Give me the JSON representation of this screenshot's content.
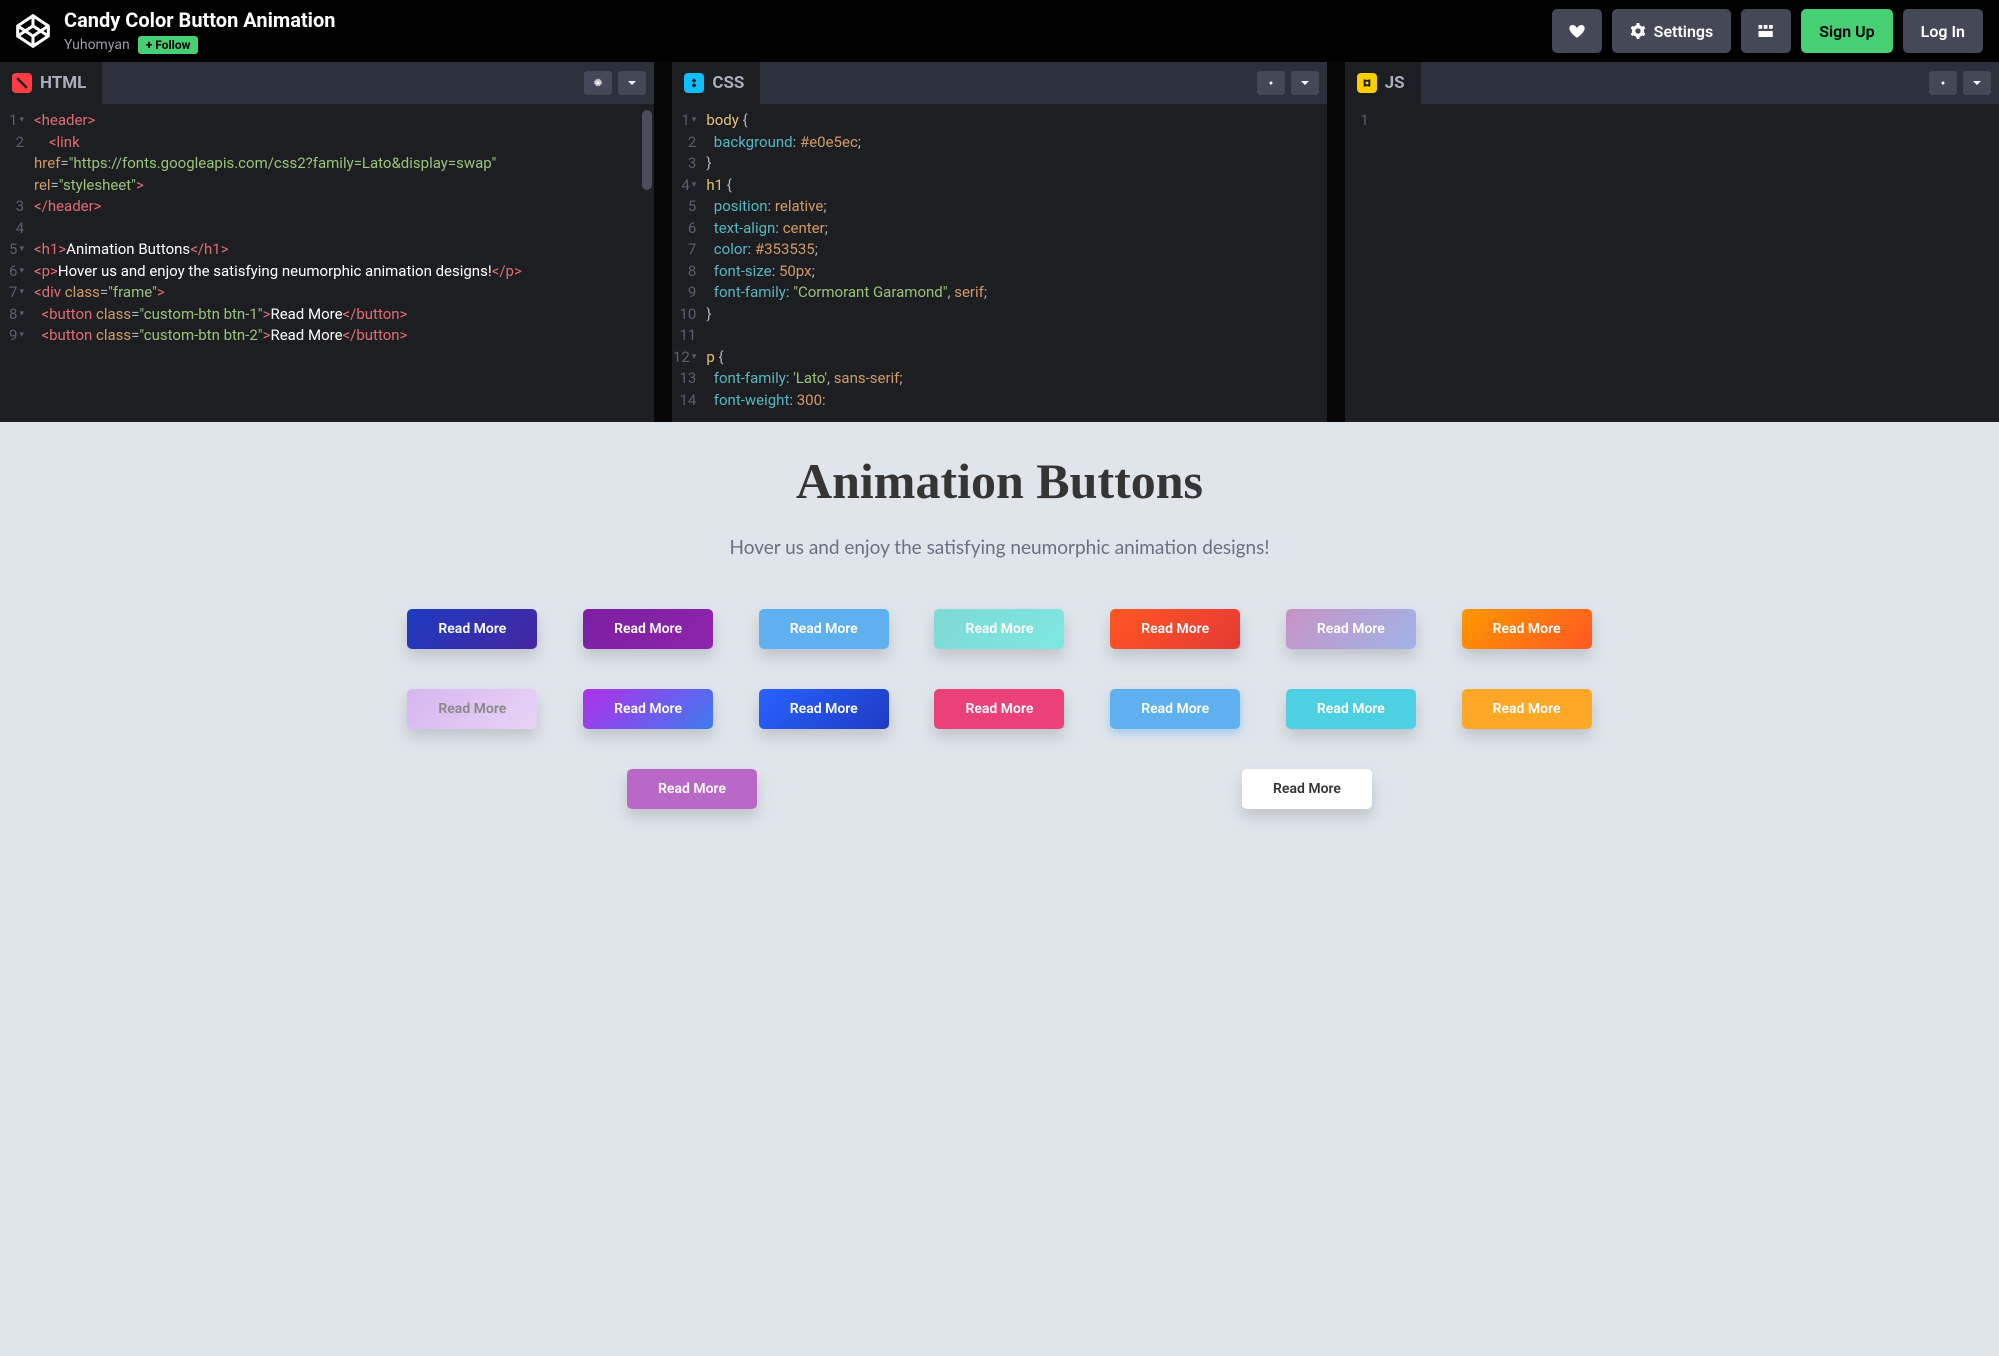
{
  "header": {
    "title": "Candy Color Button Animation",
    "author": "Yuhomyan",
    "follow": "Follow",
    "settings": "Settings",
    "signup": "Sign Up",
    "login": "Log In"
  },
  "panels": {
    "html": {
      "label": "HTML"
    },
    "css": {
      "label": "CSS"
    },
    "js": {
      "label": "JS"
    }
  },
  "html_code": {
    "lines": [
      {
        "n": "1",
        "html": "<span class='tag'>&lt;header&gt;</span>"
      },
      {
        "n": "2",
        "html": "&nbsp;&nbsp;&nbsp;&nbsp;<span class='tag'>&lt;link</span>"
      },
      {
        "n": "",
        "html": "<span class='attr'>href</span><span class='punc'>=</span><span class='str'>\"https://fonts.googleapis.com/css2?family=Lato&amp;display=swap\"</span>"
      },
      {
        "n": "",
        "html": "<span class='attr'>rel</span><span class='punc'>=</span><span class='str'>\"stylesheet\"</span><span class='tag'>&gt;</span>"
      },
      {
        "n": "3",
        "html": "<span class='tag'>&lt;/header&gt;</span>"
      },
      {
        "n": "4",
        "html": ""
      },
      {
        "n": "5",
        "html": "<span class='tag'>&lt;h1&gt;</span><span class='txt'>Animation Buttons</span><span class='tag'>&lt;/h1&gt;</span>"
      },
      {
        "n": "6",
        "html": "<span class='tag'>&lt;p&gt;</span><span class='txt'>Hover us and enjoy the satisfying neumorphic animation designs!</span><span class='tag'>&lt;/p&gt;</span>"
      },
      {
        "n": "7",
        "html": "<span class='tag'>&lt;div</span> <span class='attr'>class</span><span class='punc'>=</span><span class='str'>\"frame\"</span><span class='tag'>&gt;</span>"
      },
      {
        "n": "8",
        "html": "&nbsp;&nbsp;<span class='tag'>&lt;button</span> <span class='attr'>class</span><span class='punc'>=</span><span class='str'>\"custom-btn btn-1\"</span><span class='tag'>&gt;</span><span class='txt'>Read More</span><span class='tag'>&lt;/button&gt;</span>"
      },
      {
        "n": "9",
        "html": "&nbsp;&nbsp;<span class='tag'>&lt;button</span> <span class='attr'>class</span><span class='punc'>=</span><span class='str'>\"custom-btn btn-2\"</span><span class='tag'>&gt;</span><span class='txt'>Read More</span><span class='tag'>&lt;/button&gt;</span>"
      }
    ]
  },
  "css_code": {
    "lines": [
      {
        "n": "1",
        "html": "<span class='sel'>body</span> <span class='punc'>{</span>"
      },
      {
        "n": "2",
        "html": "&nbsp;&nbsp;<span class='prop'>background</span><span class='punc'>:</span> <span class='val'>#e0e5ec</span><span class='punc'>;</span>"
      },
      {
        "n": "3",
        "html": "<span class='punc'>}</span>"
      },
      {
        "n": "4",
        "html": "<span class='sel'>h1</span> <span class='punc'>{</span>"
      },
      {
        "n": "5",
        "html": "&nbsp;&nbsp;<span class='prop'>position</span><span class='punc'>:</span> <span class='val'>relative</span><span class='punc'>;</span>"
      },
      {
        "n": "6",
        "html": "&nbsp;&nbsp;<span class='prop'>text-align</span><span class='punc'>:</span> <span class='val'>center</span><span class='punc'>;</span>"
      },
      {
        "n": "7",
        "html": "&nbsp;&nbsp;<span class='prop'>color</span><span class='punc'>:</span> <span class='val'>#353535</span><span class='punc'>;</span>"
      },
      {
        "n": "8",
        "html": "&nbsp;&nbsp;<span class='prop'>font-size</span><span class='punc'>:</span> <span class='val'>50px</span><span class='punc'>;</span>"
      },
      {
        "n": "9",
        "html": "&nbsp;&nbsp;<span class='prop'>font-family</span><span class='punc'>:</span> <span class='str'>\"Cormorant Garamond\"</span><span class='punc'>,</span> <span class='val'>serif</span><span class='punc'>;</span>"
      },
      {
        "n": "10",
        "html": "<span class='punc'>}</span>"
      },
      {
        "n": "11",
        "html": ""
      },
      {
        "n": "12",
        "html": "<span class='sel'>p</span> <span class='punc'>{</span>"
      },
      {
        "n": "13",
        "html": "&nbsp;&nbsp;<span class='prop'>font-family</span><span class='punc'>:</span> <span class='str'>'Lato'</span><span class='punc'>,</span> <span class='val'>sans-serif</span><span class='punc'>;</span>"
      },
      {
        "n": "14",
        "html": "&nbsp;&nbsp;<span class='prop'>font-weight</span><span class='punc'>:</span> <span class='val'>300</span><span class='punc'>:</span>"
      }
    ]
  },
  "preview": {
    "heading": "Animation Buttons",
    "sub": "Hover us and enjoy the satisfying neumorphic animation designs!",
    "btn": "Read More",
    "buttons": [
      "b1",
      "b2",
      "b3",
      "b4",
      "b5",
      "b6",
      "b7",
      "b8",
      "b9",
      "b10",
      "b11",
      "b12",
      "b13",
      "b14",
      "b15",
      "b16"
    ]
  }
}
